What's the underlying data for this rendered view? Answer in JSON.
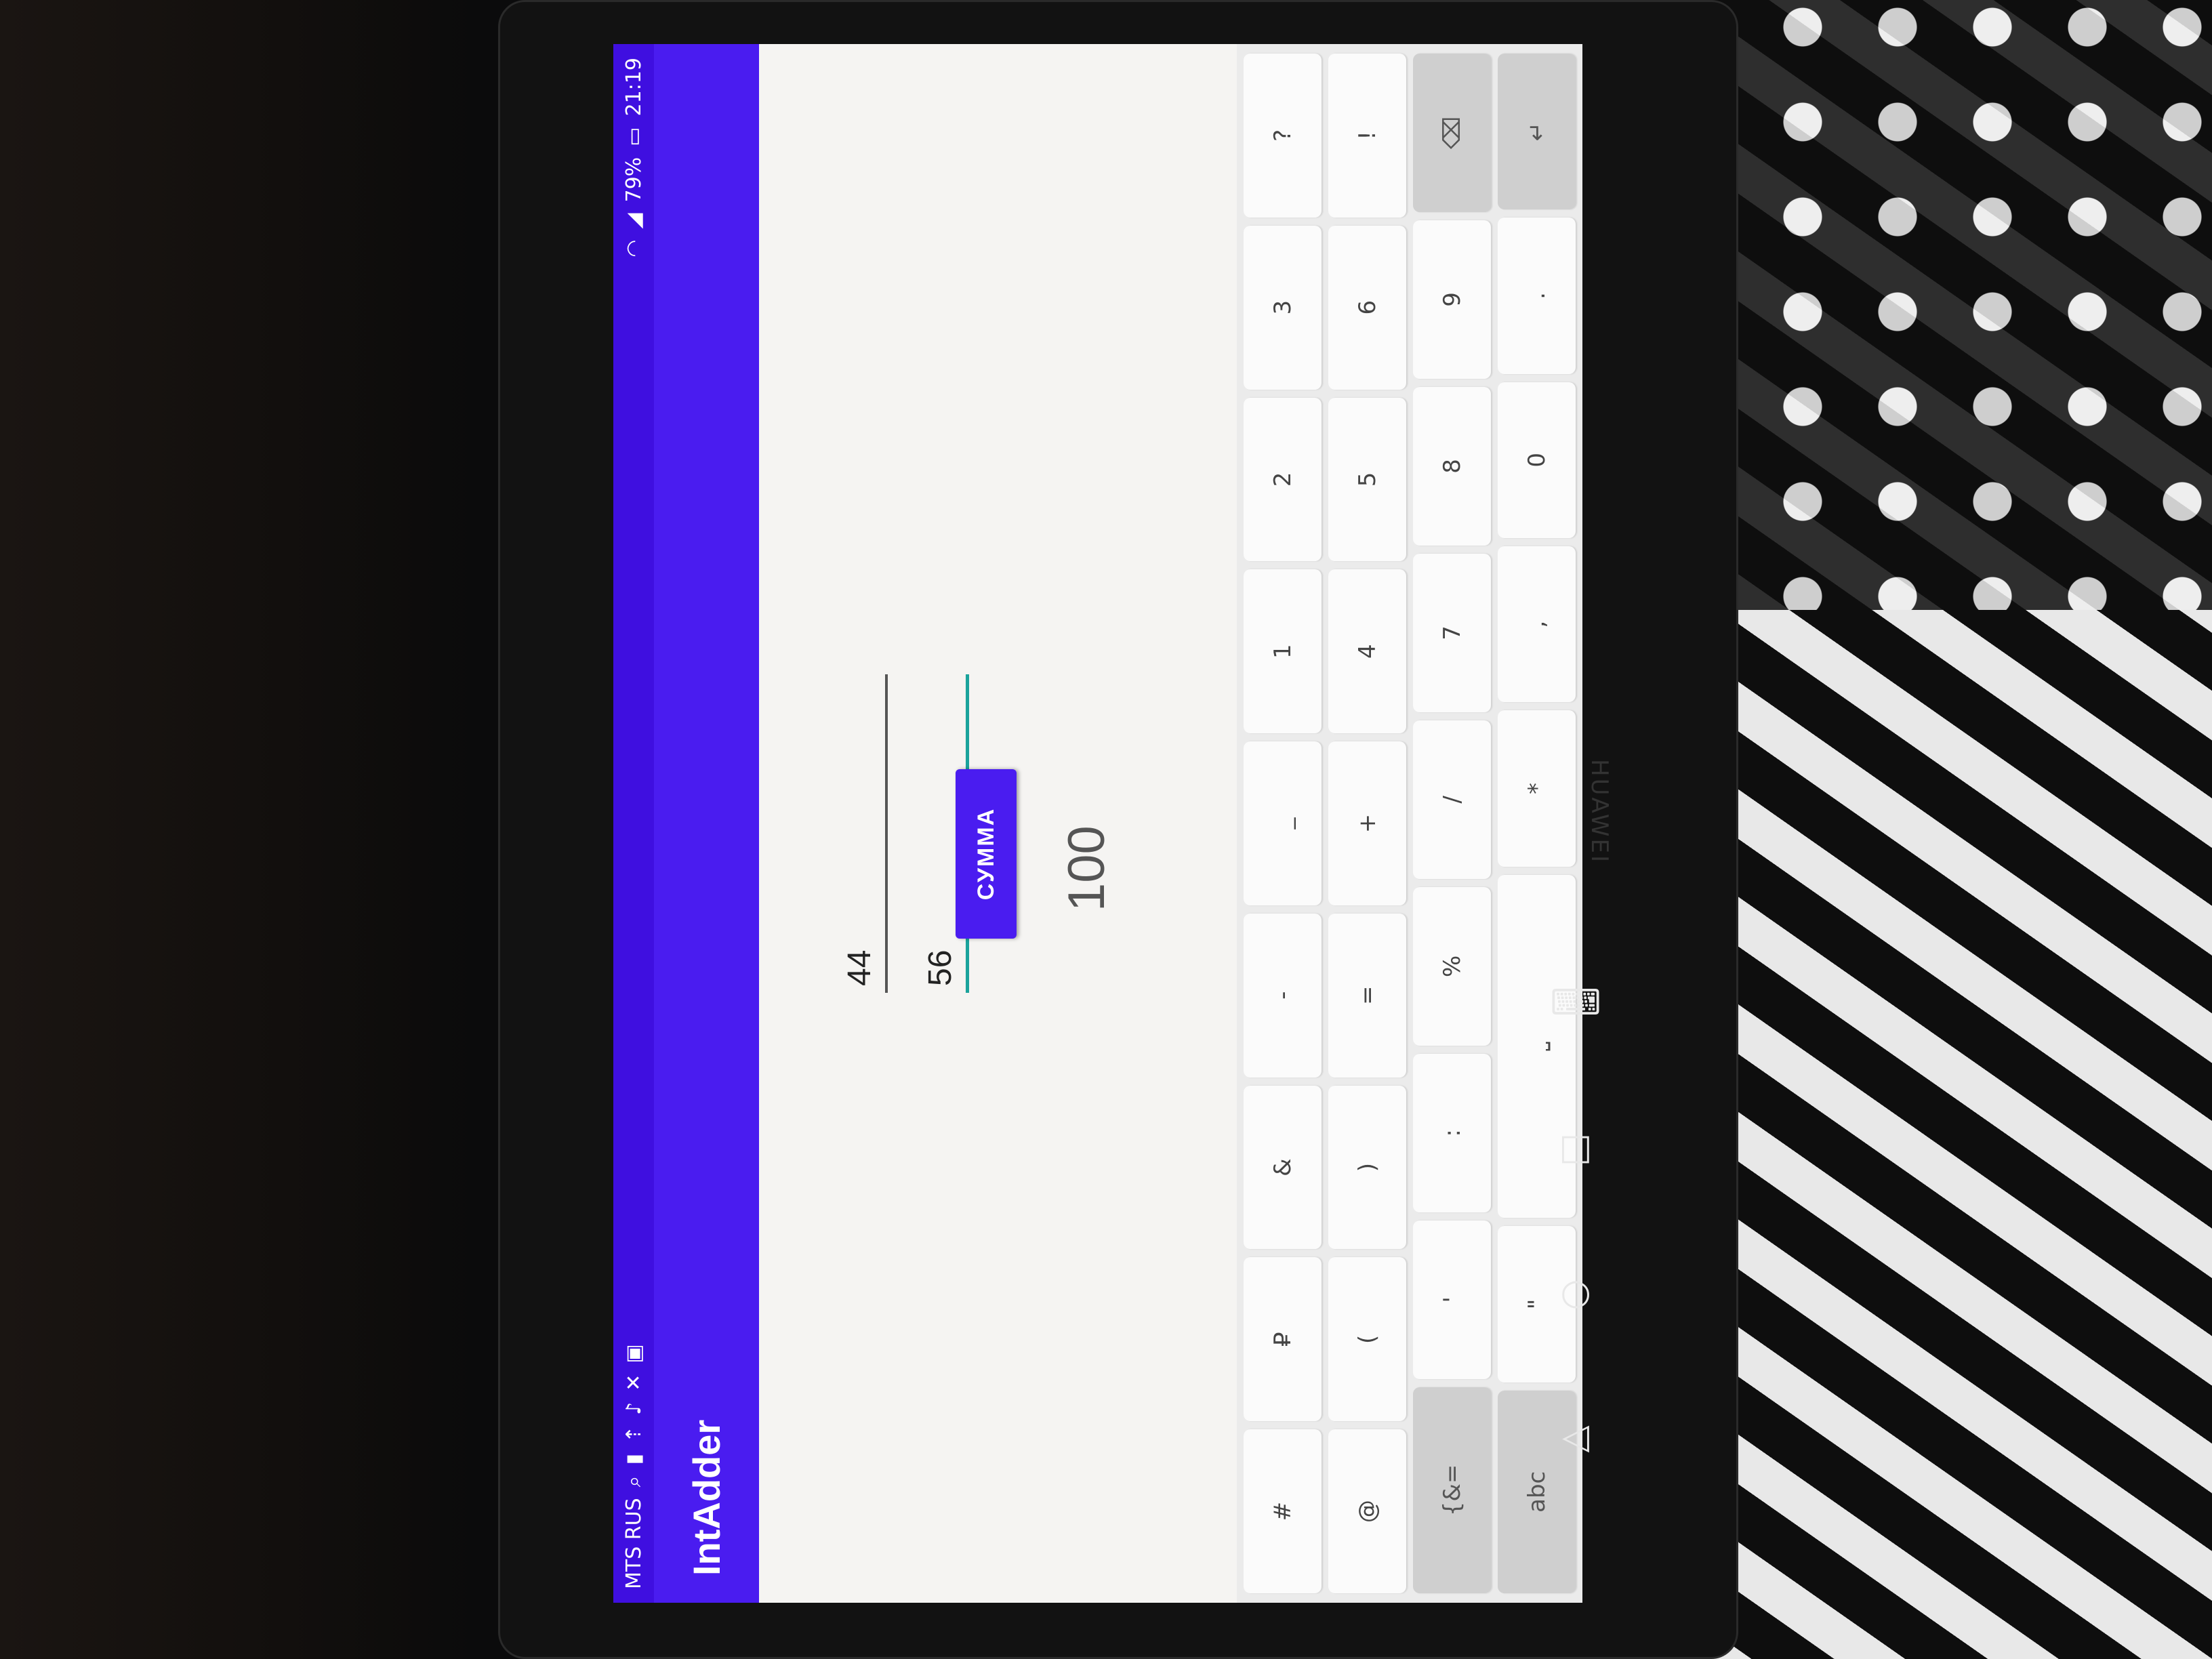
{
  "status_bar": {
    "carrier": "MTS RUS",
    "battery": "79%",
    "time": "21:19"
  },
  "app": {
    "title": "IntAdder"
  },
  "form": {
    "first_value": "44",
    "second_value": "56",
    "sum_button_label": "СУММА",
    "result": "100"
  },
  "keyboard": {
    "rows": [
      [
        "#",
        "₽",
        "&",
        "-",
        "_",
        "1",
        "2",
        "3",
        "?"
      ],
      [
        "@",
        "(",
        ")",
        "=",
        "+",
        "4",
        "5",
        "6",
        "!"
      ],
      [
        "{&=",
        "'",
        ":",
        "%",
        "/",
        "7",
        "8",
        "9"
      ],
      [
        "abc",
        "\"",
        "*",
        ",",
        "0",
        "."
      ]
    ]
  },
  "nav": {
    "back": "◁",
    "home": "○",
    "recents": "□",
    "keyboard": "⌨"
  },
  "device_brand": "HUAWEI"
}
